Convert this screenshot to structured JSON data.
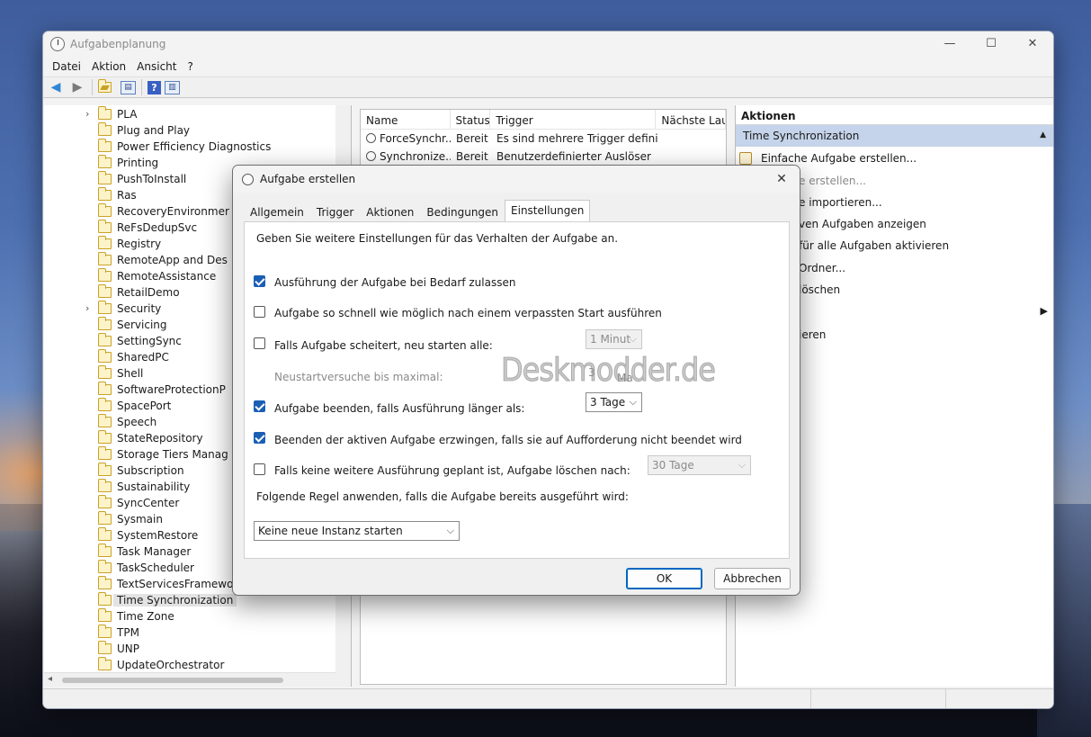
{
  "main_window": {
    "title": "Aufgabenplanung",
    "controls": {
      "minimize": "—",
      "maximize": "☐",
      "close": "✕"
    }
  },
  "menu": [
    "Datei",
    "Aktion",
    "Ansicht",
    "?"
  ],
  "tree": {
    "items": [
      {
        "label": "PLA",
        "expandable": true
      },
      {
        "label": "Plug and Play"
      },
      {
        "label": "Power Efficiency Diagnostics"
      },
      {
        "label": "Printing"
      },
      {
        "label": "PushToInstall"
      },
      {
        "label": "Ras"
      },
      {
        "label": "RecoveryEnvironmer"
      },
      {
        "label": "ReFsDedupSvc"
      },
      {
        "label": "Registry"
      },
      {
        "label": "RemoteApp and Des"
      },
      {
        "label": "RemoteAssistance"
      },
      {
        "label": "RetailDemo"
      },
      {
        "label": "Security",
        "expandable": true
      },
      {
        "label": "Servicing"
      },
      {
        "label": "SettingSync"
      },
      {
        "label": "SharedPC"
      },
      {
        "label": "Shell"
      },
      {
        "label": "SoftwareProtectionP"
      },
      {
        "label": "SpacePort"
      },
      {
        "label": "Speech"
      },
      {
        "label": "StateRepository"
      },
      {
        "label": "Storage Tiers Manag"
      },
      {
        "label": "Subscription"
      },
      {
        "label": "Sustainability"
      },
      {
        "label": "SyncCenter"
      },
      {
        "label": "Sysmain"
      },
      {
        "label": "SystemRestore"
      },
      {
        "label": "Task Manager"
      },
      {
        "label": "TaskScheduler"
      },
      {
        "label": "TextServicesFramewo"
      },
      {
        "label": "Time Synchronization",
        "selected": true
      },
      {
        "label": "Time Zone"
      },
      {
        "label": "TPM"
      },
      {
        "label": "UNP"
      },
      {
        "label": "UpdateOrchestrator"
      }
    ]
  },
  "task_list": {
    "columns": [
      "Name",
      "Status",
      "Trigger",
      "Nächste Lauf"
    ],
    "rows": [
      {
        "name": "ForceSynchr...",
        "status": "Bereit",
        "trigger": "Es sind mehrere Trigger definiert."
      },
      {
        "name": "Synchronize...",
        "status": "Bereit",
        "trigger": "Benutzerdefinierter Auslöser"
      }
    ]
  },
  "actions_pane": {
    "header": "Aktionen",
    "section": "Time Synchronization",
    "items": [
      "Einfache Aufgabe erstellen...",
      "e erstellen...",
      "e importieren...",
      "ven Aufgaben anzeigen",
      "für alle Aufgaben aktivieren",
      "Ordner...",
      "löschen",
      "",
      "ieren"
    ]
  },
  "dialog": {
    "title": "Aufgabe erstellen",
    "close": "✕",
    "tabs": [
      "Allgemein",
      "Trigger",
      "Aktionen",
      "Bedingungen",
      "Einstellungen"
    ],
    "active_tab": "Einstellungen",
    "description": "Geben Sie weitere Einstellungen für das Verhalten der Aufgabe an.",
    "options": {
      "allow_on_demand": {
        "label": "Ausführung der Aufgabe bei Bedarf zulassen",
        "checked": true
      },
      "run_missed": {
        "label": "Aufgabe so schnell wie möglich nach einem verpassten Start ausführen",
        "checked": false
      },
      "restart_on_fail": {
        "label": "Falls Aufgabe scheitert, neu starten alle:",
        "checked": false,
        "value": "1 Minut"
      },
      "restart_attempts": {
        "label": "Neustartversuche bis maximal:",
        "value": "3",
        "suffix": "Ma"
      },
      "stop_if_longer": {
        "label": "Aufgabe beenden, falls Ausführung länger als:",
        "checked": true,
        "value": "3 Tage"
      },
      "force_stop": {
        "label": "Beenden der aktiven Aufgabe erzwingen, falls sie auf Aufforderung nicht beendet wird",
        "checked": true
      },
      "delete_if_unscheduled": {
        "label": "Falls keine weitere Ausführung geplant ist, Aufgabe löschen nach:",
        "checked": false,
        "value": "30 Tage"
      }
    },
    "rule_label": "Folgende Regel anwenden, falls die Aufgabe bereits ausgeführt wird:",
    "rule_value": "Keine neue Instanz starten",
    "watermark": "Deskmodder.de",
    "ok": "OK",
    "cancel": "Abbrechen"
  }
}
